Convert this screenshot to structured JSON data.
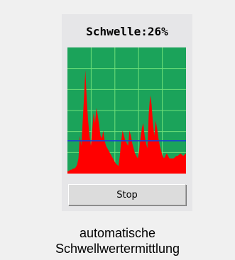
{
  "widget": {
    "title": "Schwelle:26%",
    "button_label": "Stop",
    "caption_line1": "automatische",
    "caption_line2": "Schwellwertermittlung"
  },
  "colors": {
    "plot_background": "#1ba35a",
    "grid": "#6fe07a",
    "signal": "#ff0000",
    "threshold": "#1a3fd6",
    "panel": "#e6e6e8"
  },
  "chart_data": {
    "type": "area",
    "ylim": [
      0,
      100
    ],
    "threshold": 26,
    "grid": true,
    "values": [
      2,
      2,
      3,
      3,
      4,
      4,
      5,
      7,
      12,
      30,
      22,
      40,
      60,
      82,
      58,
      42,
      30,
      22,
      35,
      48,
      40,
      52,
      46,
      38,
      30,
      28,
      34,
      26,
      22,
      20,
      18,
      16,
      14,
      12,
      10,
      8,
      7,
      6,
      14,
      26,
      34,
      30,
      26,
      24,
      22,
      34,
      30,
      24,
      20,
      16,
      14,
      12,
      18,
      28,
      36,
      40,
      30,
      24,
      20,
      48,
      62,
      55,
      40,
      30,
      42,
      36,
      28,
      22,
      18,
      14,
      12,
      14,
      16,
      14,
      12,
      12,
      12,
      12,
      13,
      14,
      14,
      15,
      16,
      15,
      14,
      15,
      16
    ]
  }
}
